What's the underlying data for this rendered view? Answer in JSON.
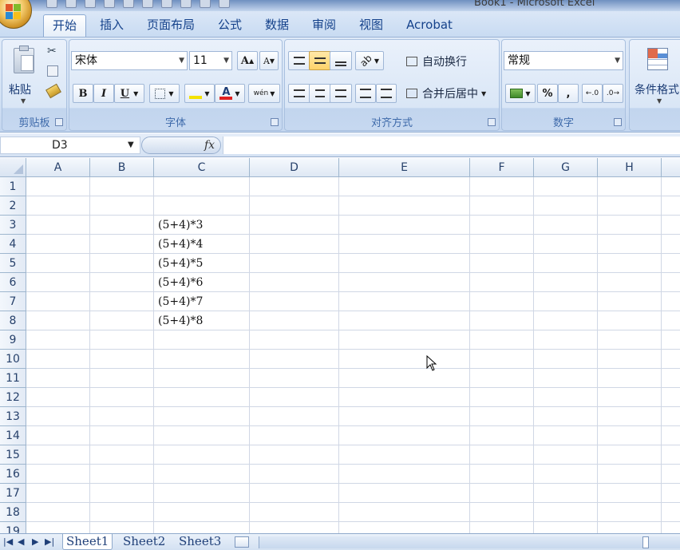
{
  "window": {
    "title": "Book1 - Microsoft Excel"
  },
  "tabs": [
    {
      "label": "开始",
      "active": true
    },
    {
      "label": "插入"
    },
    {
      "label": "页面布局"
    },
    {
      "label": "公式"
    },
    {
      "label": "数据"
    },
    {
      "label": "审阅"
    },
    {
      "label": "视图"
    },
    {
      "label": "Acrobat"
    }
  ],
  "ribbon": {
    "clipboard": {
      "label": "剪贴板",
      "paste_label": "粘贴"
    },
    "font": {
      "label": "字体",
      "font_name": "宋体",
      "font_size": "11",
      "bold": "B",
      "italic": "I",
      "underline": "U",
      "grow": "A",
      "shrink": "A",
      "phonetic": "wén"
    },
    "alignment": {
      "label": "对齐方式",
      "wrap_text": "自动换行",
      "merge_center": "合并后居中"
    },
    "number": {
      "label": "数字",
      "format": "常规",
      "percent": "%",
      "comma": ","
    },
    "styles": {
      "conditional_format": "条件格式"
    }
  },
  "formula_bar": {
    "name_box": "D3",
    "fx": "fx",
    "formula": ""
  },
  "grid": {
    "columns": [
      "A",
      "B",
      "C",
      "D",
      "E",
      "F",
      "G",
      "H"
    ],
    "rows": [
      "1",
      "2",
      "3",
      "4",
      "5",
      "6",
      "7",
      "8",
      "9",
      "10",
      "11",
      "12",
      "13",
      "14",
      "15",
      "16",
      "17",
      "18",
      "19"
    ],
    "cells": [
      {
        "ref": "C3",
        "value": "(5+4)*3"
      },
      {
        "ref": "C4",
        "value": "(5+4)*4"
      },
      {
        "ref": "C5",
        "value": "(5+4)*5"
      },
      {
        "ref": "C6",
        "value": "(5+4)*6"
      },
      {
        "ref": "C7",
        "value": "(5+4)*7"
      },
      {
        "ref": "C8",
        "value": "(5+4)*8"
      }
    ]
  },
  "sheets": [
    {
      "label": "Sheet1",
      "active": true
    },
    {
      "label": "Sheet2"
    },
    {
      "label": "Sheet3"
    }
  ],
  "colors": {
    "tab_text": "#15428b",
    "group_label": "#3e6aaa",
    "header_text": "#27416b",
    "gridline": "#d0d7e5"
  }
}
